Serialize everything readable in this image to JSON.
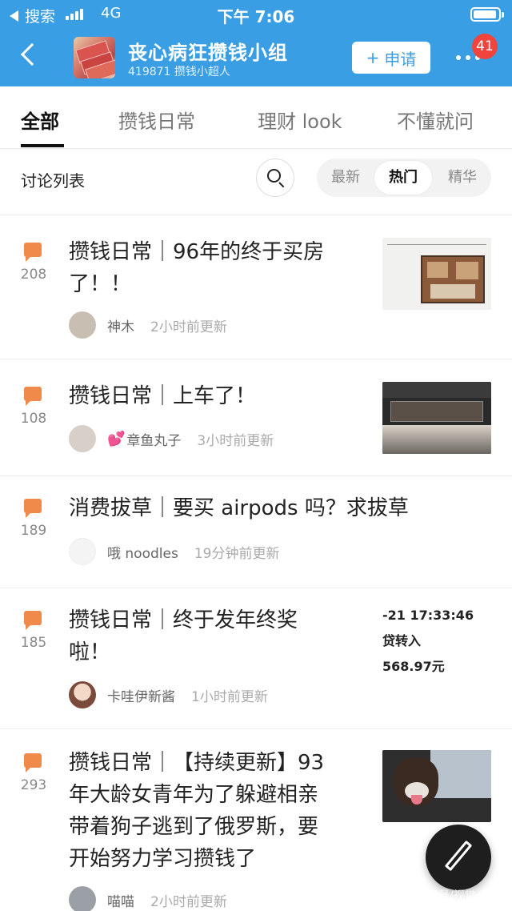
{
  "status": {
    "back_app": "搜索",
    "network": "4G",
    "time": "下午 7:06"
  },
  "header": {
    "title": "丧心病狂攒钱小组",
    "subtitle": "419871 攒钱小超人",
    "apply_label": "申请",
    "apply_icon": "+",
    "notification_count": "41"
  },
  "tabs": [
    {
      "label": "全部",
      "active": true
    },
    {
      "label": "攒钱日常",
      "active": false
    },
    {
      "label": "理财 look",
      "active": false
    },
    {
      "label": "不懂就问",
      "active": false
    }
  ],
  "toolbar": {
    "list_label": "讨论列表",
    "sort_options": [
      {
        "label": "最新",
        "active": false
      },
      {
        "label": "热门",
        "active": true
      },
      {
        "label": "精华",
        "active": false
      }
    ]
  },
  "posts": [
    {
      "count": "208",
      "title_line1": "攒钱日常｜96年的终于买房",
      "title_line2": "了！！",
      "author": "神木",
      "time": "2小时前更新",
      "thumbnail": "floor-plan"
    },
    {
      "count": "108",
      "title_line1": "攒钱日常｜上车了！",
      "author_emoji": "💕",
      "author": "章鱼丸子",
      "time": "3小时前更新",
      "thumbnail": "kitchen"
    },
    {
      "count": "189",
      "title_line1": "消费拔草｜要买 airpods 吗？求拔草",
      "author": "哦 noodles",
      "time": "19分钟前更新"
    },
    {
      "count": "185",
      "title_line1": "攒钱日常｜终于发年终奖",
      "title_line2": "啦！",
      "author": "卡哇伊新酱",
      "time": "1小时前更新",
      "receipt": [
        "-21 17:33:46",
        "贷转入",
        "568.97元"
      ]
    },
    {
      "count": "293",
      "title_line1": "攒钱日常｜【持续更新】93",
      "title_line2": "年大龄女青年为了躲避相亲",
      "title_line3": "带着狗子逃到了俄罗斯，要",
      "title_line4": "开始努力学习攒钱了",
      "author": "喵喵",
      "time": "2小时前更新",
      "thumbnail": "dog"
    }
  ],
  "watermark": "百家号/视觉",
  "colors": {
    "header_blue": "#3a9ee4",
    "bubble_orange": "#f08a4b",
    "badge_red": "#f0443c"
  }
}
